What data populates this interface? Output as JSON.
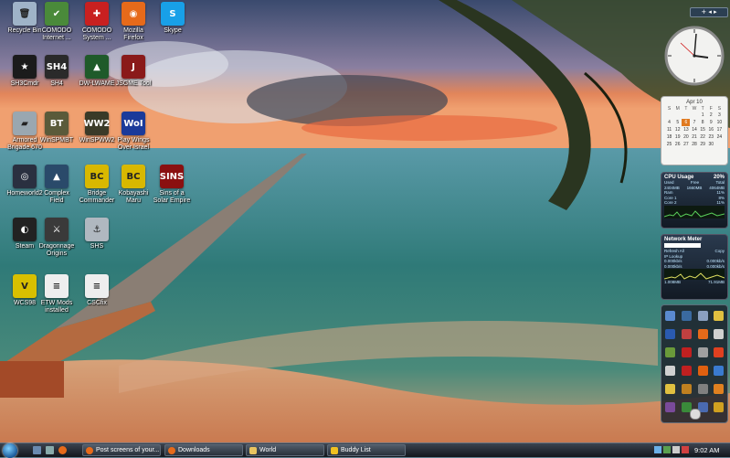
{
  "desktop_icons": [
    {
      "label": "Recycle Bin",
      "icon": "recycle-bin-icon",
      "color": "#9fb3c8",
      "glyph": "🗑"
    },
    {
      "label": "COMODO\nInternet ...",
      "icon": "comodo-shield-icon",
      "color": "#4a8a3a",
      "glyph": "✔"
    },
    {
      "label": "COMODO\nSystem ...",
      "icon": "comodo-system-icon",
      "color": "#c82020",
      "glyph": "✚"
    },
    {
      "label": "Mozilla\nFirefox",
      "icon": "firefox-icon",
      "color": "#e66a1a",
      "glyph": "◉"
    },
    {
      "label": "Skype",
      "icon": "skype-icon",
      "color": "#18a0e8",
      "glyph": "S"
    },
    {
      "label": "SH3Cmdr",
      "icon": "sh3-commander-icon",
      "color": "#1b1b1b",
      "glyph": "★"
    },
    {
      "label": "SH4",
      "icon": "sh4-icon",
      "color": "#2a2a2a",
      "glyph": "SH4"
    },
    {
      "label": "DW-LWAME",
      "icon": "dw-lwame-icon",
      "color": "#1f5a2a",
      "glyph": "▲"
    },
    {
      "label": "JSGME Tool",
      "icon": "jsgme-icon",
      "color": "#8a1a1a",
      "glyph": "J"
    },
    {
      "label": "Armored\nBrigade 670",
      "icon": "armored-brigade-icon",
      "color": "#9aa7b0",
      "glyph": "▰"
    },
    {
      "label": "WinSPMBT",
      "icon": "winspmbt-icon",
      "color": "#5a5a3a",
      "glyph": "BT"
    },
    {
      "label": "WinSPWW2",
      "icon": "winspww2-icon",
      "color": "#3a3a28",
      "glyph": "WW2"
    },
    {
      "label": "Play Wings\nOver Israel",
      "icon": "wings-over-israel-icon",
      "color": "#1a3a9a",
      "glyph": "WoI"
    },
    {
      "label": "Homeworld2",
      "icon": "homeworld-icon",
      "color": "#2a3040",
      "glyph": "◎"
    },
    {
      "label": "Complex\nField",
      "icon": "complex-field-icon",
      "color": "#2a4a6a",
      "glyph": "▲"
    },
    {
      "label": "Bridge\nCommander",
      "icon": "bridge-commander-icon",
      "color": "#d8b800",
      "glyph": "BC"
    },
    {
      "label": "Kobayashi\nMaru",
      "icon": "kobayashi-maru-icon",
      "color": "#d8b800",
      "glyph": "BC"
    },
    {
      "label": "Sins of a\nSolar Empire",
      "icon": "sins-solar-empire-icon",
      "color": "#8a1010",
      "glyph": "SINS"
    },
    {
      "label": "Steam",
      "icon": "steam-icon",
      "color": "#222",
      "glyph": "◐"
    },
    {
      "label": "Dragonnage\nOrigins",
      "icon": "dragon-age-icon",
      "color": "#3a3a3a",
      "glyph": "⚔"
    },
    {
      "label": "SHS",
      "icon": "shs-icon",
      "color": "#b0b8c0",
      "glyph": "⚓"
    },
    {
      "label": "WCS98",
      "icon": "wcs-icon",
      "color": "#d8c000",
      "glyph": "V"
    },
    {
      "label": "ETW Mods\ninstalled",
      "icon": "text-document-icon",
      "color": "#eeeeee",
      "glyph": "≡"
    },
    {
      "label": "CSCfix",
      "icon": "text-document-icon",
      "color": "#eeeeee",
      "glyph": "≡"
    }
  ],
  "gadgets": {
    "calendar": {
      "month": "Apr 10",
      "days": [
        "S",
        "M",
        "T",
        "W",
        "T",
        "F",
        "S"
      ],
      "dates": [
        "",
        "",
        "",
        "",
        "1",
        "2",
        "3",
        "4",
        "5",
        "6",
        "7",
        "8",
        "9",
        "10",
        "11",
        "12",
        "13",
        "14",
        "15",
        "16",
        "17",
        "18",
        "19",
        "20",
        "21",
        "22",
        "23",
        "24",
        "25",
        "26",
        "27",
        "28",
        "29",
        "30"
      ],
      "today": "6"
    },
    "cpu": {
      "title": "CPU Usage",
      "value": "20%",
      "cols": [
        "Used",
        "Free",
        "Total"
      ],
      "row1": [
        "2404MB",
        "1660MB",
        "4064MB"
      ],
      "ram": "Ram",
      "ram_pct": "11%",
      "core1": "Core 1",
      "core1_pct": "8%",
      "core2": "Core 2",
      "core2_pct": "11%"
    },
    "network": {
      "title": "Network Meter",
      "refresh": "Refresh All",
      "ip_lookup": "IP Lookup",
      "copy": "Copy",
      "up1": "0.000kb/s",
      "up1b": "0.000kb/s",
      "down1": "0.000kb/s",
      "down1b": "0.000kb/s",
      "total_up": "1.008MB",
      "total_down": "71.91MB"
    }
  },
  "taskbar": {
    "start": "start-orb",
    "buttons": [
      {
        "label": "Post screens of your...",
        "icon": "firefox-icon"
      },
      {
        "label": "Downloads",
        "icon": "firefox-icon"
      },
      {
        "label": "World",
        "icon": "folder-icon"
      },
      {
        "label": "Buddy List",
        "icon": "chat-icon"
      }
    ],
    "clock": "9:02 AM"
  },
  "colors": {
    "taskbar": "#1a1f27",
    "gadget_bg": "#1d2734",
    "accent": "#5aa0e0"
  }
}
